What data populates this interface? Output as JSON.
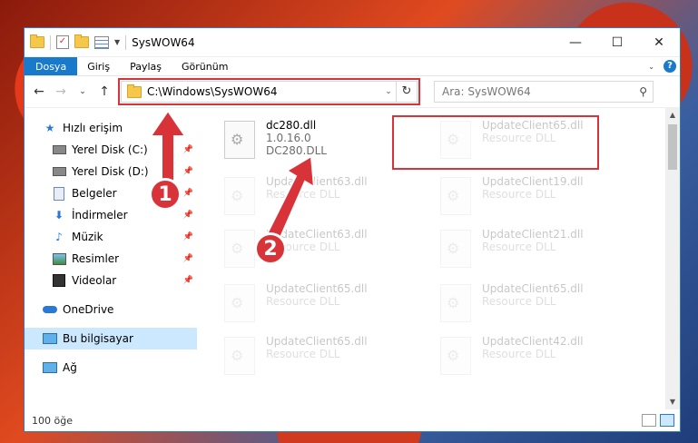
{
  "window": {
    "title": "SysWOW64"
  },
  "ribbon": {
    "tabs": [
      "Dosya",
      "Giriş",
      "Paylaş",
      "Görünüm"
    ]
  },
  "address": {
    "path": "C:\\Windows\\SysWOW64",
    "search_placeholder": "Ara: SysWOW64"
  },
  "sidebar": {
    "items": [
      {
        "label": "Hızlı erişim"
      },
      {
        "label": "Yerel Disk (C:)"
      },
      {
        "label": "Yerel Disk (D:)"
      },
      {
        "label": "Belgeler"
      },
      {
        "label": "İndirmeler"
      },
      {
        "label": "Müzik"
      },
      {
        "label": "Resimler"
      },
      {
        "label": "Videolar"
      },
      {
        "label": "OneDrive"
      },
      {
        "label": "Bu bilgisayar"
      },
      {
        "label": "Ağ"
      }
    ]
  },
  "files": [
    {
      "name": "dc280.dll",
      "line2": "1.0.16.0",
      "line3": "DC280.DLL"
    },
    {
      "name": "UpdateClient63.dll",
      "line2": "Resource DLL"
    },
    {
      "name": "UpdateClient63.dll",
      "line2": "Resource DLL"
    },
    {
      "name": "UpdateClient65.dll",
      "line2": "Resource DLL"
    },
    {
      "name": "UpdateClient65.dll",
      "line2": "Resource DLL"
    },
    {
      "name": "UpdateClient65.dll",
      "line2": "Resource DLL"
    },
    {
      "name": "UpdateClient19.dll",
      "line2": "Resource DLL"
    },
    {
      "name": "UpdateClient21.dll",
      "line2": "Resource DLL"
    },
    {
      "name": "UpdateClient65.dll",
      "line2": "Resource DLL"
    },
    {
      "name": "UpdateClient42.dll",
      "line2": "Resource DLL"
    }
  ],
  "status": {
    "count": "100 öğe"
  },
  "callouts": [
    "1",
    "2"
  ],
  "colors": {
    "accent": "#1979ca",
    "highlight": "#d9333a",
    "selected": "#cce8ff"
  }
}
